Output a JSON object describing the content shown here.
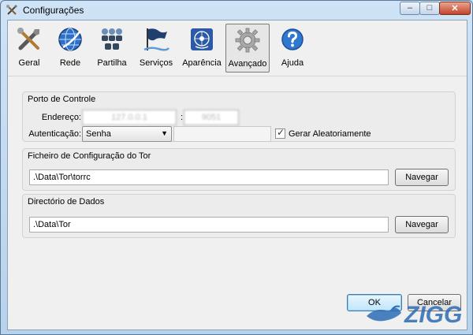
{
  "window": {
    "title": "Configurações",
    "controls": {
      "minimize": "–",
      "maximize": "□",
      "close": "✕"
    }
  },
  "toolbar": {
    "items": [
      {
        "label": "Geral",
        "icon": "tools-icon"
      },
      {
        "label": "Rede",
        "icon": "globe-icon"
      },
      {
        "label": "Partilha",
        "icon": "people-icon"
      },
      {
        "label": "Serviços",
        "icon": "flag-icon"
      },
      {
        "label": "Aparência",
        "icon": "un-emblem-icon"
      },
      {
        "label": "Avançado",
        "icon": "gear-icon",
        "active": true
      },
      {
        "label": "Ajuda",
        "icon": "help-icon"
      }
    ]
  },
  "control_port": {
    "title": "Porto de Controle",
    "address_label": "Endereço:",
    "address_value": "127.0.0.1",
    "port_separator": ":",
    "port_value": "9051",
    "auth_label": "Autenticação:",
    "auth_selected": "Senha",
    "password_value": "",
    "random_checkbox_label": "Gerar Aleatoriamente",
    "random_checked": true
  },
  "tor_config": {
    "title": "Ficheiro de Configuração do Tor",
    "path": ".\\Data\\Tor\\torrc",
    "browse_label": "Navegar"
  },
  "data_dir": {
    "title": "Directório de Dados",
    "path": ".\\Data\\Tor",
    "browse_label": "Navegar"
  },
  "footer": {
    "ok_label": "OK",
    "cancel_label": "Cancelar"
  },
  "watermark": {
    "text": "ZIGG"
  },
  "colors": {
    "accent": "#3c7fb1",
    "titlebar": "#cfe3f6"
  }
}
